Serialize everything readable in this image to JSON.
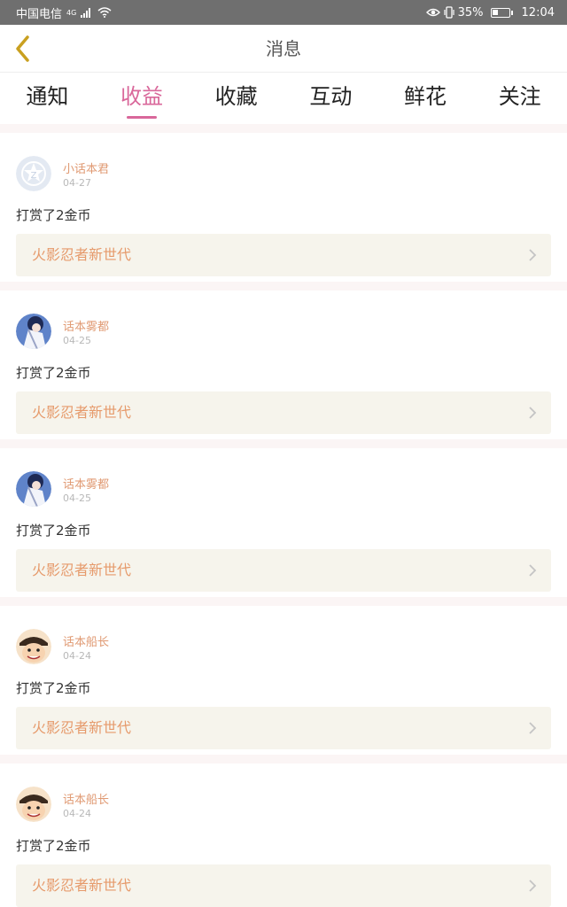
{
  "status_bar": {
    "carrier": "中国电信",
    "network": "4G",
    "battery": "35%",
    "time": "12:04"
  },
  "header": {
    "title": "消息",
    "back_icon": "chevron-left-icon"
  },
  "tabs": [
    {
      "label": "通知",
      "active": false
    },
    {
      "label": "收益",
      "active": true
    },
    {
      "label": "收藏",
      "active": false
    },
    {
      "label": "互动",
      "active": false
    },
    {
      "label": "鲜花",
      "active": false
    },
    {
      "label": "关注",
      "active": false
    }
  ],
  "messages": [
    {
      "user": "小话本君",
      "date": "04-27",
      "text": "打赏了2金币",
      "work": "火影忍者新世代",
      "avatar": "logo-avatar"
    },
    {
      "user": "话本雾都",
      "date": "04-25",
      "text": "打赏了2金币",
      "work": "火影忍者新世代",
      "avatar": "anime-character-avatar"
    },
    {
      "user": "话本雾都",
      "date": "04-25",
      "text": "打赏了2金币",
      "work": "火影忍者新世代",
      "avatar": "anime-character-avatar"
    },
    {
      "user": "话本船长",
      "date": "04-24",
      "text": "打赏了2金币",
      "work": "火影忍者新世代",
      "avatar": "straw-hat-avatar"
    },
    {
      "user": "话本船长",
      "date": "04-24",
      "text": "打赏了2金币",
      "work": "火影忍者新世代",
      "avatar": "straw-hat-avatar"
    }
  ],
  "colors": {
    "accent": "#d9679a",
    "username": "#e09a73",
    "work_title": "#e69a6b",
    "work_bg": "#f6f4ec",
    "back_arrow": "#c9a020"
  }
}
